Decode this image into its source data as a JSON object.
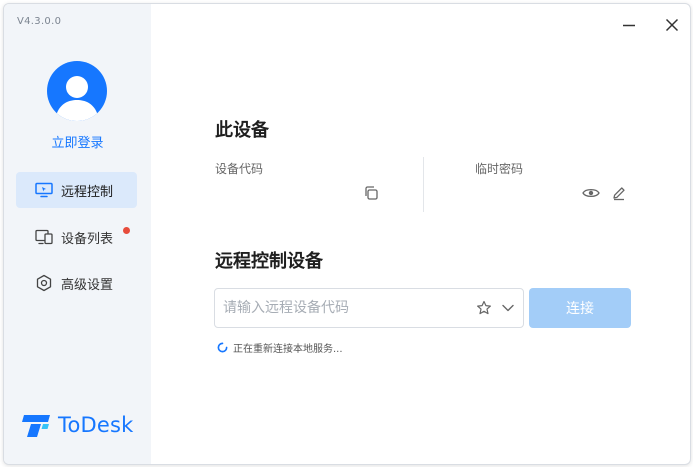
{
  "app": {
    "version": "V4.3.0.0",
    "brand_name": "ToDesk",
    "accent_color": "#1677ff"
  },
  "sidebar": {
    "login_label": "立即登录",
    "items": [
      {
        "label": "远程控制",
        "icon": "monitor-icon",
        "active": true
      },
      {
        "label": "设备列表",
        "icon": "devices-icon",
        "has_notification": true
      },
      {
        "label": "高级设置",
        "icon": "settings-hexagon-icon"
      }
    ]
  },
  "window_controls": {
    "minimize_icon": "minimize-icon",
    "close_icon": "close-icon"
  },
  "device_section": {
    "title": "此设备",
    "device_code_label": "设备代码",
    "device_code_value": "",
    "temp_password_label": "临时密码",
    "temp_password_value": ""
  },
  "remote_section": {
    "title": "远程控制设备",
    "input_placeholder": "请输入远程设备代码",
    "input_value": "",
    "connect_label": "连接",
    "connect_color": "#a3cdf8",
    "status_text": "正在重新连接本地服务..."
  }
}
